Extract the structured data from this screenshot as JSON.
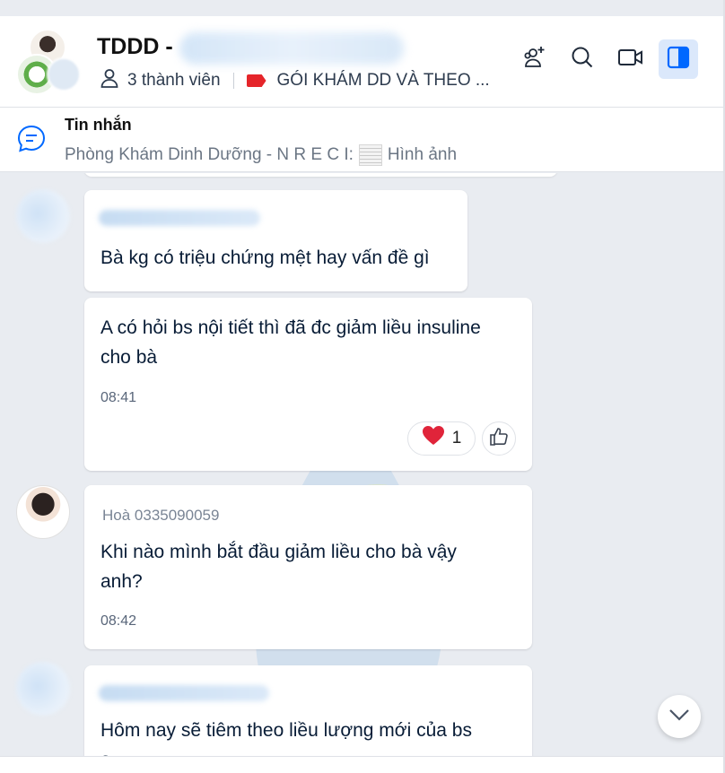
{
  "header": {
    "title": "TDDD -",
    "members": "3 thành viên",
    "label": "GÓI KHÁM DD VÀ THEO ...",
    "label_color": "#e5252a"
  },
  "pinned": {
    "title": "Tin nhắn",
    "sender": "Phòng Khám Dinh Dưỡng - N R E C I:",
    "content": "Hình ảnh"
  },
  "messages": [
    {
      "text": "Bà kg có triệu chứng mệt hay vấn đề gì"
    },
    {
      "text_line1": "A có hỏi bs nội tiết thì đã đc giảm liều insuline",
      "text_line2": "cho bà",
      "time": "08:41",
      "reaction_count": "1"
    },
    {
      "sender": "Hoà 0335090059",
      "text_line1": "Khi nào mình bắt đầu giảm liều cho bà vậy",
      "text_line2": "anh?",
      "time": "08:42"
    },
    {
      "text_line1": "Hôm nay sẽ tiêm theo liều lượng mới của bs",
      "text_line2": "ạ"
    }
  ],
  "colors": {
    "accent": "#0068ff",
    "active_button_bg": "#dbe8fb",
    "background": "#e9ecf1"
  }
}
